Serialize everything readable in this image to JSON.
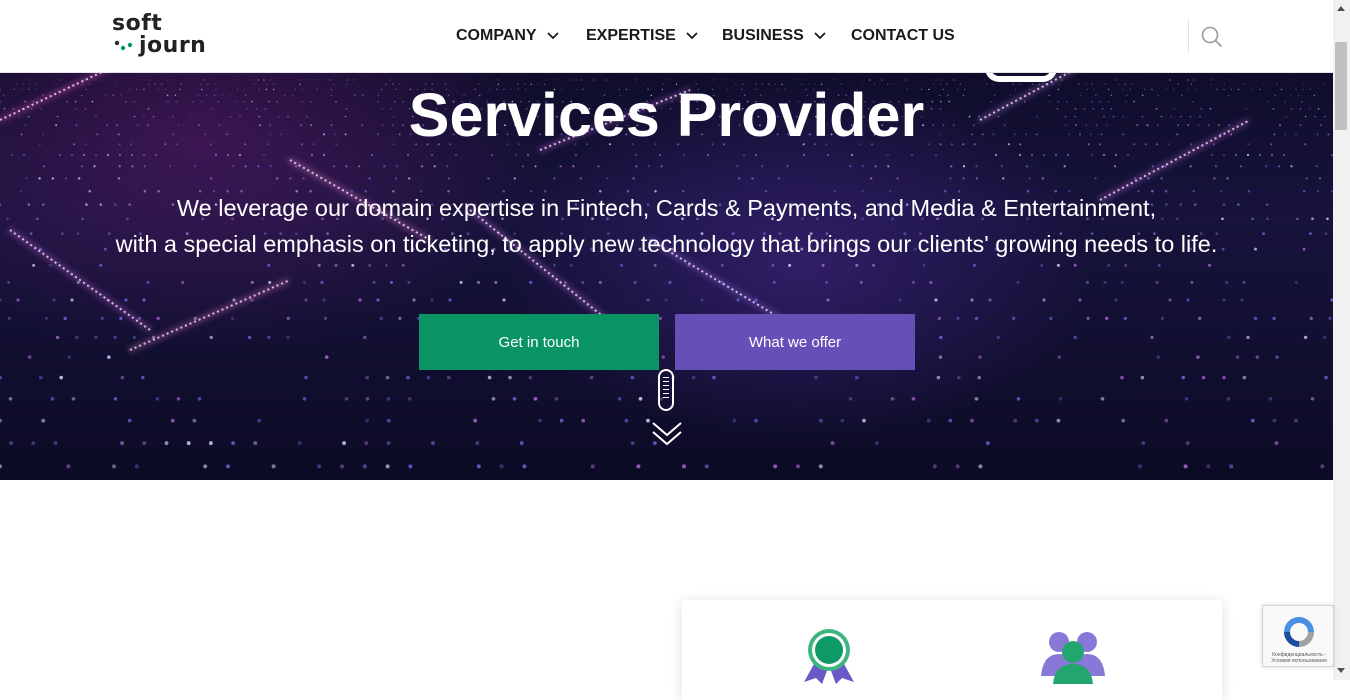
{
  "header": {
    "logo_line1": "soft",
    "logo_line2": "journ",
    "nav": [
      {
        "label": "COMPANY",
        "has_dropdown": true
      },
      {
        "label": "EXPERTISE",
        "has_dropdown": true
      },
      {
        "label": "BUSINESS",
        "has_dropdown": true
      },
      {
        "label": "CONTACT US",
        "has_dropdown": false
      }
    ],
    "search_icon": "search-icon"
  },
  "hero": {
    "title": "Services Provider",
    "subtitle_line1": "We leverage our domain expertise in Fintech, Cards & Payments, and Media & Entertainment,",
    "subtitle_line2": "with a special emphasis on ticketing, to apply new technology that brings our clients' growing needs to life.",
    "primary_button": "Get in touch",
    "secondary_button": "What we offer",
    "scroll_indicator": "scroll-down-icon"
  },
  "card": {
    "icons": [
      "award-icon",
      "team-icon"
    ]
  },
  "recaptcha": {
    "terms_line1": "Конфиденциальность -",
    "terms_line2": "Условия использования"
  },
  "colors": {
    "green": "#0b9463",
    "purple": "#6550b8",
    "dark_text": "#1a1a1a",
    "hero_bg": "#17133c"
  }
}
